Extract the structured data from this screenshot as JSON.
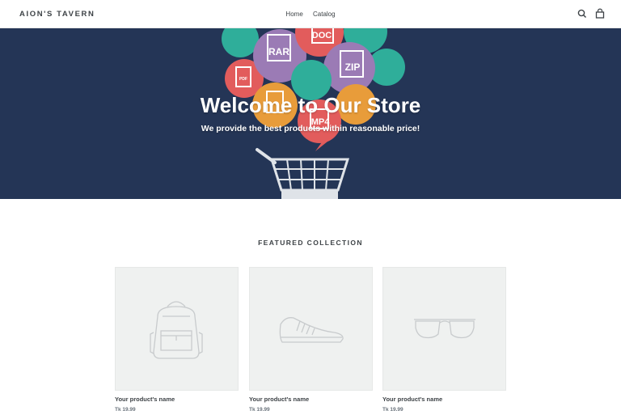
{
  "header": {
    "logo": "AION'S TAVERN",
    "nav": [
      {
        "label": "Home"
      },
      {
        "label": "Catalog"
      }
    ],
    "icons": [
      "search-icon",
      "cart-icon"
    ]
  },
  "hero": {
    "title": "Welcome to Our Store",
    "subtitle": "We provide the best products within reasonable price!",
    "bubbles": [
      "RAR",
      "DOC",
      "ZIP",
      "PDF",
      "MP4"
    ]
  },
  "featured": {
    "title": "FEATURED COLLECTION",
    "products": [
      {
        "name": "Your product's name",
        "price": "Tk 19.99",
        "icon": "backpack-icon"
      },
      {
        "name": "Your product's name",
        "price": "Tk 19.99",
        "icon": "shoe-icon"
      },
      {
        "name": "Your product's name",
        "price": "Tk 19.99",
        "icon": "glasses-icon"
      }
    ]
  },
  "colors": {
    "hero_bg": "#243556",
    "placeholder_bg": "#eff1f0",
    "text_dark": "#3d4246"
  }
}
